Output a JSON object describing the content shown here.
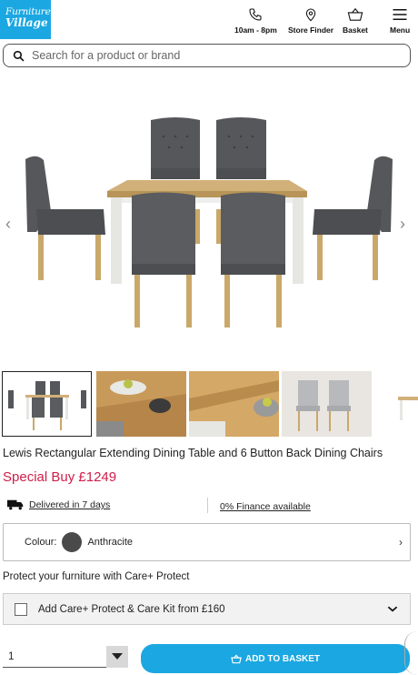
{
  "header": {
    "logo_line1": "Furniture",
    "logo_line2": "Village",
    "hours_label": "10am - 8pm",
    "store_finder_label": "Store Finder",
    "basket_label": "Basket",
    "menu_label": "Menu"
  },
  "search": {
    "placeholder": "Search for a product or brand"
  },
  "product": {
    "title": "Lewis Rectangular Extending Dining Table and 6 Button Back Dining Chairs",
    "price": "Special Buy £1249",
    "delivery": "Delivered in 7 days",
    "finance": "0% Finance available",
    "colour_label": "Colour:",
    "colour_value": "Anthracite",
    "colour_hex": "#4a4a4a"
  },
  "gallery": {
    "thumbnail_count": 5,
    "selected_index": 0
  },
  "protection": {
    "heading": "Protect your furniture with Care+ Protect",
    "option_label": "Add Care+ Protect & Care Kit from £160",
    "checked": false
  },
  "purchase": {
    "quantity": "1",
    "add_button_label": "ADD TO BASKET"
  },
  "colors": {
    "brand_blue": "#1ba7e1",
    "price_red": "#d11d4a"
  }
}
